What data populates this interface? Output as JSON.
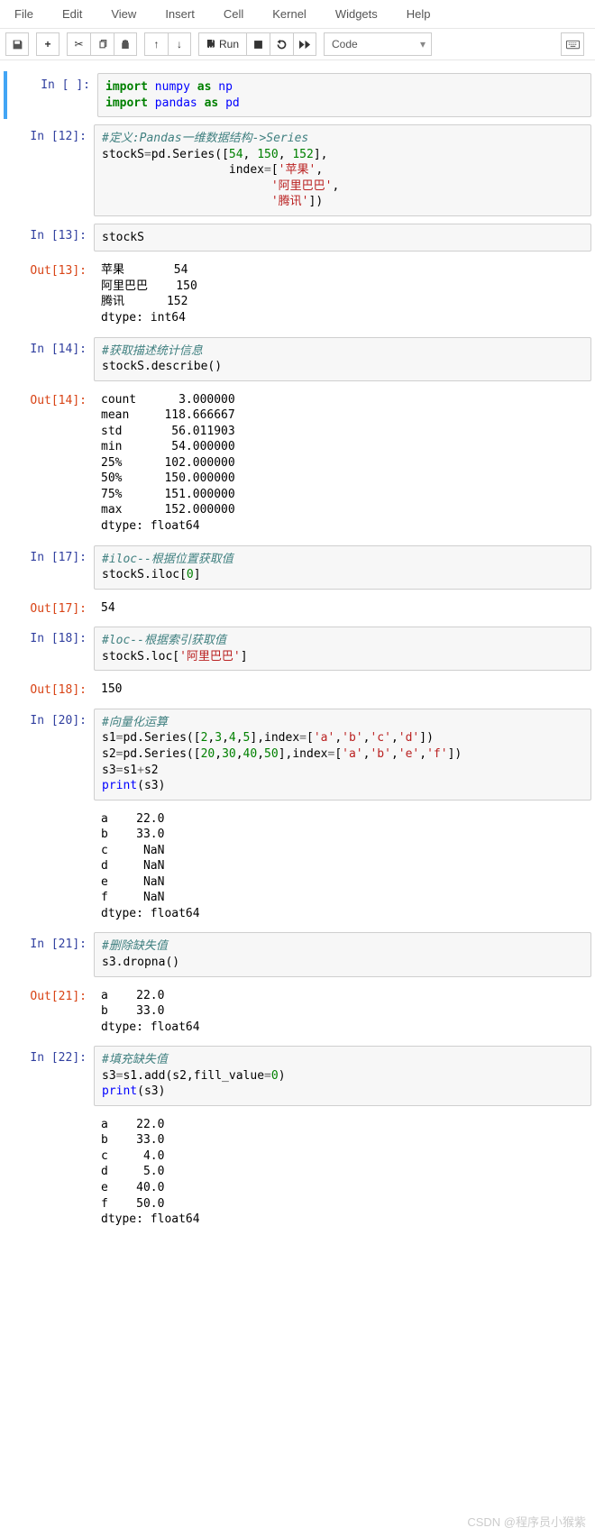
{
  "menu": {
    "items": [
      "File",
      "Edit",
      "View",
      "Insert",
      "Cell",
      "Kernel",
      "Widgets",
      "Help"
    ]
  },
  "toolbar": {
    "run_label": "Run",
    "celltype": "Code"
  },
  "cells": [
    {
      "type": "code",
      "exec": null,
      "running": true,
      "source_html": "<span class='kw'>import</span> <span class='nn'>numpy</span> <span class='kw'>as</span> <span class='nn'>np</span>\n<span class='kw'>import</span> <span class='nn'>pandas</span> <span class='kw'>as</span> <span class='nn'>pd</span>"
    },
    {
      "type": "code",
      "exec": 12,
      "source_html": "<span class='cm'>#定义:Pandas一维数据结构-&gt;Series</span>\nstockS<span class='op'>=</span>pd.Series([<span class='num'>54</span>, <span class='num'>150</span>, <span class='num'>152</span>],\n                  index<span class='op'>=</span>[<span class='str'>'苹果'</span>,\n                        <span class='str'>'阿里巴巴'</span>,\n                        <span class='str'>'腾讯'</span>])"
    },
    {
      "type": "code",
      "exec": 13,
      "source_html": "stockS",
      "output": "苹果       54\n阿里巴巴    150\n腾讯      152\ndtype: int64"
    },
    {
      "type": "code",
      "exec": 14,
      "source_html": "<span class='cm'>#获取描述统计信息</span>\nstockS.describe()",
      "output": "count      3.000000\nmean     118.666667\nstd       56.011903\nmin       54.000000\n25%      102.000000\n50%      150.000000\n75%      151.000000\nmax      152.000000\ndtype: float64"
    },
    {
      "type": "code",
      "exec": 17,
      "source_html": "<span class='cm'>#iloc--根据位置获取值</span>\nstockS.iloc[<span class='num'>0</span>]",
      "output": "54"
    },
    {
      "type": "code",
      "exec": 18,
      "source_html": "<span class='cm'>#loc--根据索引获取值</span>\nstockS.loc[<span class='str'>'阿里巴巴'</span>]",
      "output": "150"
    },
    {
      "type": "code",
      "exec": 20,
      "source_html": "<span class='cm'>#向量化运算</span>\ns1<span class='op'>=</span>pd.Series([<span class='num'>2</span>,<span class='num'>3</span>,<span class='num'>4</span>,<span class='num'>5</span>],index<span class='op'>=</span>[<span class='str'>'a'</span>,<span class='str'>'b'</span>,<span class='str'>'c'</span>,<span class='str'>'d'</span>])\ns2<span class='op'>=</span>pd.Series([<span class='num'>20</span>,<span class='num'>30</span>,<span class='num'>40</span>,<span class='num'>50</span>],index<span class='op'>=</span>[<span class='str'>'a'</span>,<span class='str'>'b'</span>,<span class='str'>'e'</span>,<span class='str'>'f'</span>])\ns3<span class='op'>=</span>s1<span class='op'>+</span>s2\n<span class='fn'>print</span>(s3)",
      "stdout": "a    22.0\nb    33.0\nc     NaN\nd     NaN\ne     NaN\nf     NaN\ndtype: float64"
    },
    {
      "type": "code",
      "exec": 21,
      "source_html": "<span class='cm'>#删除缺失值</span>\ns3.dropna()",
      "output": "a    22.0\nb    33.0\ndtype: float64"
    },
    {
      "type": "code",
      "exec": 22,
      "source_html": "<span class='cm'>#填充缺失值</span>\ns3<span class='op'>=</span>s1.add(s2,fill_value<span class='op'>=</span><span class='num'>0</span>)\n<span class='fn'>print</span>(s3)",
      "stdout": "a    22.0\nb    33.0\nc     4.0\nd     5.0\ne    40.0\nf    50.0\ndtype: float64"
    }
  ],
  "watermark": "CSDN @程序员小猴紫"
}
